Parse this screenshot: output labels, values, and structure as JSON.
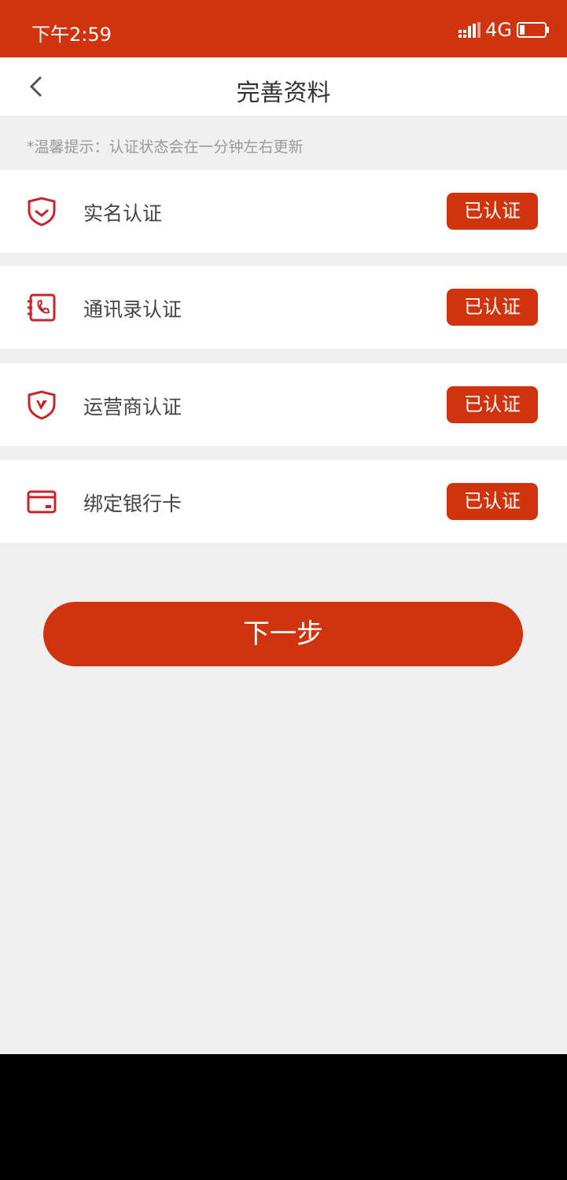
{
  "status_bar": {
    "time": "下午2:59",
    "network": "4G"
  },
  "header": {
    "title": "完善资料"
  },
  "tip": "*温馨提示：认证状态会在一分钟左右更新",
  "items": [
    {
      "label": "实名认证",
      "status": "已认证",
      "icon": "shield-check-icon"
    },
    {
      "label": "通讯录认证",
      "status": "已认证",
      "icon": "contacts-book-icon"
    },
    {
      "label": "运营商认证",
      "status": "已认证",
      "icon": "shield-v-icon"
    },
    {
      "label": "绑定银行卡",
      "status": "已认证",
      "icon": "bank-card-icon"
    }
  ],
  "next_button": "下一步",
  "colors": {
    "accent": "#cf340e",
    "background": "#f0f0f0",
    "icon": "#c8252b"
  }
}
